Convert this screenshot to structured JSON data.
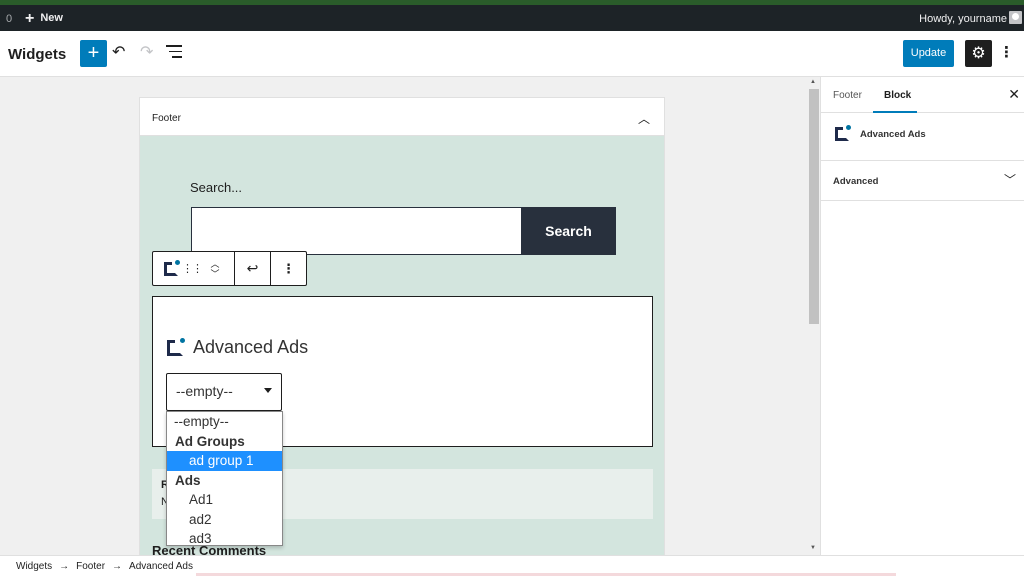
{
  "admin_bar": {
    "count": "0",
    "new_label": "New",
    "howdy": "Howdy, yourname"
  },
  "header": {
    "title": "Widgets",
    "update_label": "Update"
  },
  "widget_area": {
    "title": "Footer",
    "search_label": "Search...",
    "search_button": "Search"
  },
  "ads_block": {
    "title": "Advanced Ads",
    "select_value": "--empty--"
  },
  "dropdown": {
    "items": [
      {
        "type": "option",
        "label": "--empty--"
      },
      {
        "type": "group",
        "label": "Ad Groups"
      },
      {
        "type": "option",
        "label": "ad group 1",
        "selected": true
      },
      {
        "type": "group",
        "label": "Ads"
      },
      {
        "type": "option",
        "label": "Ad1"
      },
      {
        "type": "option",
        "label": "ad2"
      },
      {
        "type": "option",
        "label": "ad3"
      }
    ]
  },
  "partial_block": {
    "title_initial": "R",
    "text_initial": "N"
  },
  "recent_comments": "Recent Comments",
  "sidebar": {
    "tab_footer": "Footer",
    "tab_block": "Block",
    "block_name": "Advanced Ads",
    "advanced": "Advanced"
  },
  "breadcrumb": {
    "items": [
      "Widgets",
      "Footer",
      "Advanced Ads"
    ],
    "separator": "→"
  },
  "colors": {
    "accent": "#007cba",
    "admin_bar": "#1d2327",
    "widget_bg": "#d3e5de",
    "search_button": "#28303d",
    "selected_option": "#1e90ff"
  }
}
